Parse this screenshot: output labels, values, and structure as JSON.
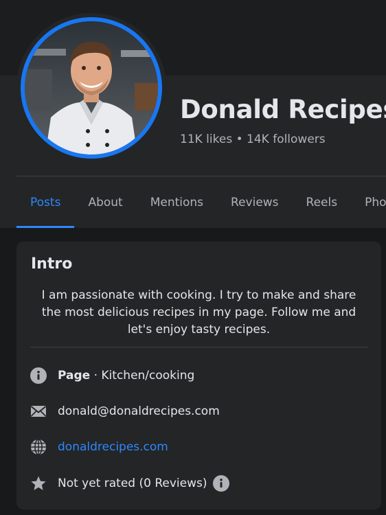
{
  "profile": {
    "name": "Donald Recipes",
    "stats": "11K likes • 14K followers"
  },
  "tabs": [
    {
      "label": "Posts",
      "active": true
    },
    {
      "label": "About"
    },
    {
      "label": "Mentions"
    },
    {
      "label": "Reviews"
    },
    {
      "label": "Reels"
    },
    {
      "label": "Photos"
    }
  ],
  "intro": {
    "title": "Intro",
    "bio": "I am passionate with cooking. I try to make and share the most delicious recipes in my page. Follow me and let's enjoy tasty recipes.",
    "page_label": "Page",
    "page_separator": " · ",
    "category": "Kitchen/cooking",
    "email": "donald@donaldrecipes.com",
    "website": "donaldrecipes.com",
    "rating": "Not yet rated (0 Reviews)"
  },
  "icons": {
    "page": "info-circle-icon",
    "email": "envelope-icon",
    "website": "globe-icon",
    "rating": "star-icon",
    "rating_info": "info-circle-icon"
  },
  "colors": {
    "accent": "#2d88ff",
    "ring": "#1877f2",
    "card": "#242526",
    "background": "#18191a"
  }
}
